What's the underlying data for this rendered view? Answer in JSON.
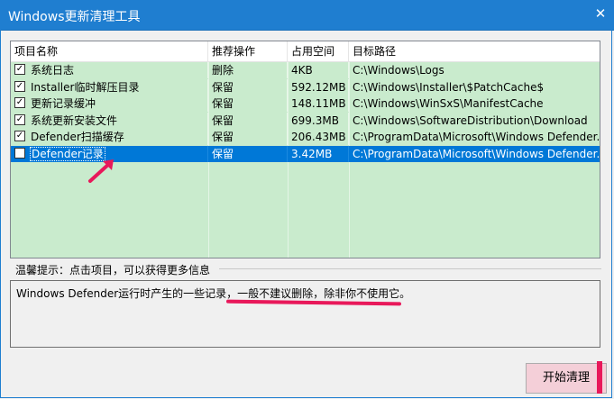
{
  "window": {
    "title": "Windows更新清理工具",
    "close_glyph": "✕"
  },
  "list": {
    "columns": [
      "项目名称",
      "推荐操作",
      "占用空间",
      "目标路径"
    ],
    "rows": [
      {
        "checked": true,
        "name": "系统日志",
        "action": "删除",
        "size": "4KB",
        "path": "C:\\Windows\\Logs"
      },
      {
        "checked": true,
        "name": "Installer临时解压目录",
        "action": "保留",
        "size": "592.12MB",
        "path": "C:\\Windows\\Installer\\$PatchCache$"
      },
      {
        "checked": true,
        "name": "更新记录缓冲",
        "action": "保留",
        "size": "148.11MB",
        "path": "C:\\Windows\\WinSxS\\ManifestCache"
      },
      {
        "checked": true,
        "name": "系统更新安装文件",
        "action": "保留",
        "size": "699.3MB",
        "path": "C:\\Windows\\SoftwareDistribution\\Download"
      },
      {
        "checked": true,
        "name": "Defender扫描缓存",
        "action": "保留",
        "size": "206.43MB",
        "path": "C:\\ProgramData\\Microsoft\\Windows Defender..."
      },
      {
        "checked": false,
        "name": "Defender记录",
        "action": "保留",
        "size": "3.42MB",
        "path": "C:\\ProgramData\\Microsoft\\Windows Defender...",
        "selected": true
      }
    ]
  },
  "hint": {
    "label": "温馨提示：点击项目，可以获得更多信息"
  },
  "description": "Windows Defender运行时产生的一些记录，一般不建议删除，除非你不使用它。",
  "start_button": {
    "label": "开始清理"
  },
  "colors": {
    "titlebar": "#1f7ed0",
    "list_bg": "#c9ebcd",
    "selection": "#0078d7",
    "annotation": "#e8185a"
  }
}
